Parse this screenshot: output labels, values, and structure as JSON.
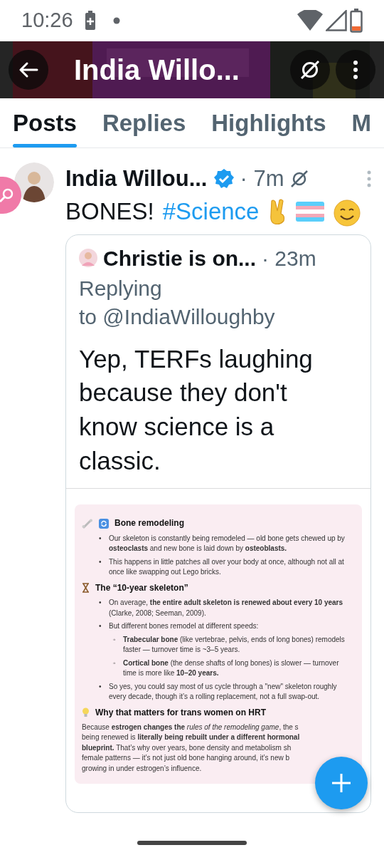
{
  "status_bar": {
    "time": "10:26"
  },
  "header": {
    "title": "India Willo..."
  },
  "tabs": [
    {
      "label": "Posts",
      "selected": true
    },
    {
      "label": "Replies",
      "selected": false
    },
    {
      "label": "Highlights",
      "selected": false
    },
    {
      "label": "M",
      "selected": false
    }
  ],
  "post": {
    "author": "India Willou...",
    "verified": true,
    "time": "· 7m",
    "text": "BONES!",
    "hashtag": "#Science",
    "quote": {
      "author": "Christie is on...",
      "time": "· 23m",
      "replying": "Replying",
      "replying_to": "to @IndiaWilloughby",
      "text": "Yep, TERFs laughing because they don't know science is a classic.",
      "attachment": {
        "sections": [
          {
            "heading": "Bone remodeling",
            "items": [
              {
                "marker": "•",
                "text": "Our skeleton is constantly being remodeled — old bone gets chewed up by **osteoclasts** and new bone is laid down by **osteoblasts.**"
              },
              {
                "marker": "•",
                "text": "This happens in little patches all over your body at once, although not all at once like swapping out Lego bricks."
              }
            ]
          },
          {
            "heading": "The “10-year skeleton”",
            "items": [
              {
                "marker": "•",
                "text": "On average, **the entire adult skeleton is renewed about every 10 years** (Clarke, 2008; Seeman, 2009)."
              },
              {
                "marker": "•",
                "text": "But different bones remodel at different speeds:",
                "children": [
                  {
                    "marker": "◦",
                    "text": "**Trabecular bone** (like vertebrae, pelvis, ends of long bones) remodels faster — turnover time is ~3–5 years."
                  },
                  {
                    "marker": "◦",
                    "text": "**Cortical bone** (the dense shafts of long bones) is slower — turnover time is more like **10–20 years.**"
                  }
                ]
              },
              {
                "marker": "•",
                "text": "So yes, you could say most of us cycle through a \"new\" skeleton roughly every decade, though it’s a rolling replacement, not a full swap-out."
              }
            ]
          },
          {
            "heading": "Why that matters for trans women on HRT",
            "lines": [
              "Because **estrogen changes the** *rules of the remodeling game*, the s",
              "being renewed is **literally being rebuilt under a different hormonal**",
              "**blueprint.** That’s why over years, bone density and metabolism sh",
              "female patterns — it’s not just old bone hanging around, it’s new b",
              "growing in under estrogen’s influence."
            ]
          }
        ]
      }
    }
  }
}
